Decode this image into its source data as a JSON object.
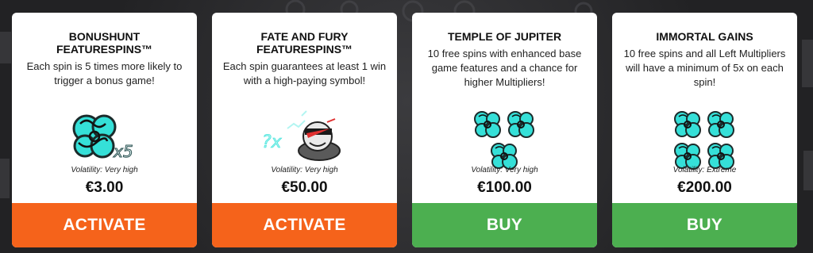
{
  "colors": {
    "orange": "#f5631b",
    "green": "#4caf50",
    "cyan": "#35e0d8"
  },
  "cards": [
    {
      "title": "BONUSHUNT FEATURESPINS™",
      "description": "Each spin is 5 times more likely to trigger a bonus game!",
      "icon": "bonus-symbol-x5-icon",
      "volatility": "Volatility: Very high",
      "price": "€3.00",
      "button_label": "ACTIVATE",
      "button_color": "orange"
    },
    {
      "title": "FATE AND FURY FEATURESPINS™",
      "description": "Each spin guarantees at least 1 win with a high-paying symbol!",
      "icon": "high-paying-symbol-icon",
      "volatility": "Volatility: Very high",
      "price": "€50.00",
      "button_label": "ACTIVATE",
      "button_color": "orange"
    },
    {
      "title": "TEMPLE OF JUPITER",
      "description": "10 free spins with enhanced base game features and a chance for higher Multipliers!",
      "icon": "three-scatter-symbols-icon",
      "volatility": "Volatility: Very high",
      "price": "€100.00",
      "button_label": "BUY",
      "button_color": "green"
    },
    {
      "title": "IMMORTAL GAINS",
      "description": "10 free spins and all Left Multipliers will have a minimum of 5x on each spin!",
      "icon": "four-scatter-symbols-icon",
      "volatility": "Volatility: Extreme",
      "price": "€200.00",
      "button_label": "BUY",
      "button_color": "green"
    }
  ],
  "art": {
    "multiplier_text": "x5",
    "fate_text": "?x"
  }
}
